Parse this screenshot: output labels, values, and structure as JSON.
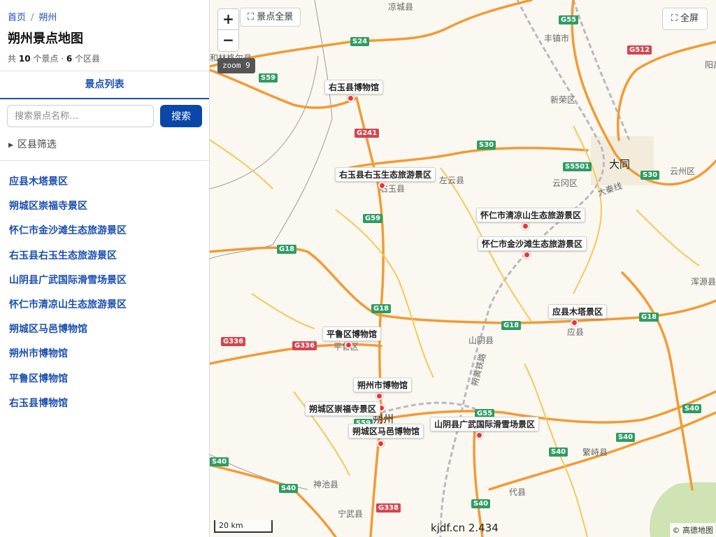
{
  "sidebar": {
    "breadcrumb": [
      "首页",
      "朔州"
    ],
    "breadcrumb_sep": "/",
    "title": "朔州景点地图",
    "meta": {
      "prefix": "共",
      "spots_count": "10",
      "spots_unit": "个景点 ·",
      "districts_count": "6",
      "districts_unit": "个区县"
    },
    "tab": "景点列表",
    "search": {
      "placeholder": "搜索景点名称…",
      "button": "搜索"
    },
    "filter_label": "区县筛选",
    "spots": [
      "应县木塔景区",
      "朔城区崇福寺景区",
      "怀仁市金沙滩生态旅游景区",
      "右玉县右玉生态旅游景区",
      "山阴县广武国际滑雪场景区",
      "怀仁市清凉山生态旅游景区",
      "朔城区马邑博物馆",
      "朔州市博物馆",
      "平鲁区博物馆",
      "右玉县博物馆"
    ]
  },
  "map": {
    "zoom_in": "+",
    "zoom_out": "−",
    "overview_button": "景点全景",
    "fullscreen_button": "全屏",
    "zoom_level": "zoom 9",
    "scale": "20 km",
    "attribution": "© 高德地图",
    "watermark": "kjdf.cn 2.434",
    "markers": [
      "右玉县博物馆",
      "右玉县右玉生态旅游景区",
      "怀仁市清凉山生态旅游景区",
      "怀仁市金沙滩生态旅游景区",
      "应县木塔景区",
      "平鲁区博物馆",
      "朔州市博物馆",
      "朔城区崇福寺景区",
      "朔城区马邑博物馆",
      "山阴县广武国际滑雪场景区"
    ],
    "places": [
      "凉城县",
      "丰镇市",
      "新荣区",
      "和林格尔县",
      "阳高",
      "大同",
      "云州区",
      "云冈区",
      "左云县",
      "右玉县",
      "浑源县",
      "山阴县",
      "应县",
      "平鲁区",
      "朔州",
      "繁峙县",
      "代县",
      "神池县",
      "宁武县",
      "大秦线",
      "朔黄铁路"
    ],
    "road_shields": {
      "green": [
        "G55",
        "S24",
        "S59",
        "S30",
        "S5501",
        "S30",
        "G59",
        "G18",
        "G18",
        "G18",
        "G18",
        "G55",
        "S59",
        "S40",
        "S40",
        "S40",
        "S40",
        "S40",
        "S40"
      ],
      "red": [
        "G512",
        "G241",
        "G336",
        "G336",
        "G338"
      ]
    }
  }
}
